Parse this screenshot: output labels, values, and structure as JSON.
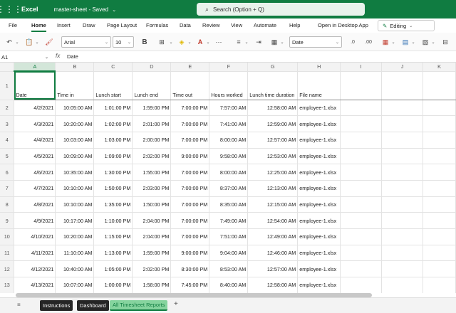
{
  "titlebar": {
    "app_name": "Excel",
    "doc_name": "master-sheet",
    "doc_status": "Saved",
    "search_placeholder": "Search (Option + Q)"
  },
  "menu": {
    "items": [
      "File",
      "Home",
      "Insert",
      "Draw",
      "Page Layout",
      "Formulas",
      "Data",
      "Review",
      "View",
      "Automate",
      "Help",
      "Open in Desktop App"
    ],
    "active": "Home",
    "editing_label": "Editing"
  },
  "toolbar": {
    "font_name": "Arial",
    "font_size": "10",
    "number_format": "Date"
  },
  "formula_bar": {
    "name_box": "A1",
    "fx": "fx",
    "content": "Date"
  },
  "grid": {
    "columns": [
      "A",
      "B",
      "C",
      "D",
      "E",
      "F",
      "G",
      "H",
      "I",
      "J",
      "K"
    ],
    "header_row": [
      "Date",
      "Time in",
      "Lunch start",
      "Lunch end",
      "Time out",
      "Hours worked",
      "Lunch time duration",
      "File name",
      "",
      "",
      ""
    ],
    "rows": [
      [
        "4/2/2021",
        "10:05:00 AM",
        "1:01:00 PM",
        "1:59:00 PM",
        "7:00:00 PM",
        "7:57:00 AM",
        "12:58:00 AM",
        "employee-1.xlsx"
      ],
      [
        "4/3/2021",
        "10:20:00 AM",
        "1:02:00 PM",
        "2:01:00 PM",
        "7:00:00 PM",
        "7:41:00 AM",
        "12:59:00 AM",
        "employee-1.xlsx"
      ],
      [
        "4/4/2021",
        "10:03:00 AM",
        "1:03:00 PM",
        "2:00:00 PM",
        "7:00:00 PM",
        "8:00:00 AM",
        "12:57:00 AM",
        "employee-1.xlsx"
      ],
      [
        "4/5/2021",
        "10:09:00 AM",
        "1:09:00 PM",
        "2:02:00 PM",
        "9:00:00 PM",
        "9:58:00 AM",
        "12:53:00 AM",
        "employee-1.xlsx"
      ],
      [
        "4/6/2021",
        "10:35:00 AM",
        "1:30:00 PM",
        "1:55:00 PM",
        "7:00:00 PM",
        "8:00:00 AM",
        "12:25:00 AM",
        "employee-1.xlsx"
      ],
      [
        "4/7/2021",
        "10:10:00 AM",
        "1:50:00 PM",
        "2:03:00 PM",
        "7:00:00 PM",
        "8:37:00 AM",
        "12:13:00 AM",
        "employee-1.xlsx"
      ],
      [
        "4/8/2021",
        "10:10:00 AM",
        "1:35:00 PM",
        "1:50:00 PM",
        "7:00:00 PM",
        "8:35:00 AM",
        "12:15:00 AM",
        "employee-1.xlsx"
      ],
      [
        "4/9/2021",
        "10:17:00 AM",
        "1:10:00 PM",
        "2:04:00 PM",
        "7:00:00 PM",
        "7:49:00 AM",
        "12:54:00 AM",
        "employee-1.xlsx"
      ],
      [
        "4/10/2021",
        "10:20:00 AM",
        "1:15:00 PM",
        "2:04:00 PM",
        "7:00:00 PM",
        "7:51:00 AM",
        "12:49:00 AM",
        "employee-1.xlsx"
      ],
      [
        "4/11/2021",
        "11:10:00 AM",
        "1:13:00 PM",
        "1:59:00 PM",
        "9:00:00 PM",
        "9:04:00 AM",
        "12:46:00 AM",
        "employee-1.xlsx"
      ],
      [
        "4/12/2021",
        "10:40:00 AM",
        "1:05:00 PM",
        "2:02:00 PM",
        "8:30:00 PM",
        "8:53:00 AM",
        "12:57:00 AM",
        "employee-1.xlsx"
      ],
      [
        "4/13/2021",
        "10:07:00 AM",
        "1:00:00 PM",
        "1:58:00 PM",
        "7:45:00 PM",
        "8:40:00 AM",
        "12:58:00 AM",
        "employee-1.xlsx"
      ]
    ]
  },
  "sheets": {
    "tabs": [
      "Instructions",
      "Dashboard",
      "All Timesheet Reports"
    ],
    "active": "All Timesheet Reports"
  },
  "colors": {
    "brand": "#107c41",
    "active_tab": "#86d49e"
  }
}
